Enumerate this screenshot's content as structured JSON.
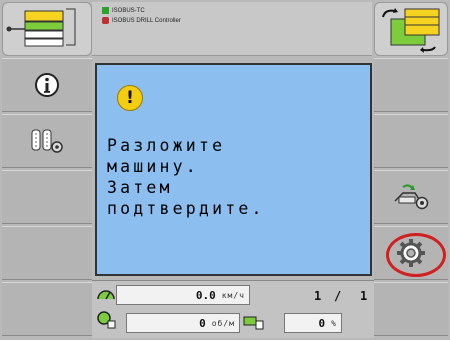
{
  "header": {
    "line1": "ISOBUS-TC",
    "line2": "ISOBUS DRILL Controller",
    "left_icon": "implement-layout-icon",
    "right_icon": "switch-screen-icon"
  },
  "left_softkeys": [
    {
      "icon": "info-icon"
    },
    {
      "icon": "seed-settings-icon"
    },
    {
      "icon": ""
    },
    {
      "icon": ""
    },
    {
      "icon": ""
    }
  ],
  "right_softkeys": [
    {
      "icon": ""
    },
    {
      "icon": ""
    },
    {
      "icon": "machine-settings-icon"
    },
    {
      "icon": "gear-icon"
    },
    {
      "icon": ""
    }
  ],
  "dialog": {
    "icon": "warning-icon",
    "icon_glyph": "!",
    "lines": [
      "Разложите",
      "машину.",
      "Затем",
      "подтвердите."
    ]
  },
  "status": {
    "speed_value": "0.0",
    "speed_unit": "км/ч",
    "page_current": "1",
    "page_separator": "/",
    "page_total": "1",
    "rpm_value": "0",
    "rpm_unit": "об/м",
    "percent_value": "0",
    "percent_unit": "%"
  },
  "colors": {
    "dialog_bg": "#8cbef0",
    "warning": "#f4cc10",
    "highlight": "#d02020"
  }
}
